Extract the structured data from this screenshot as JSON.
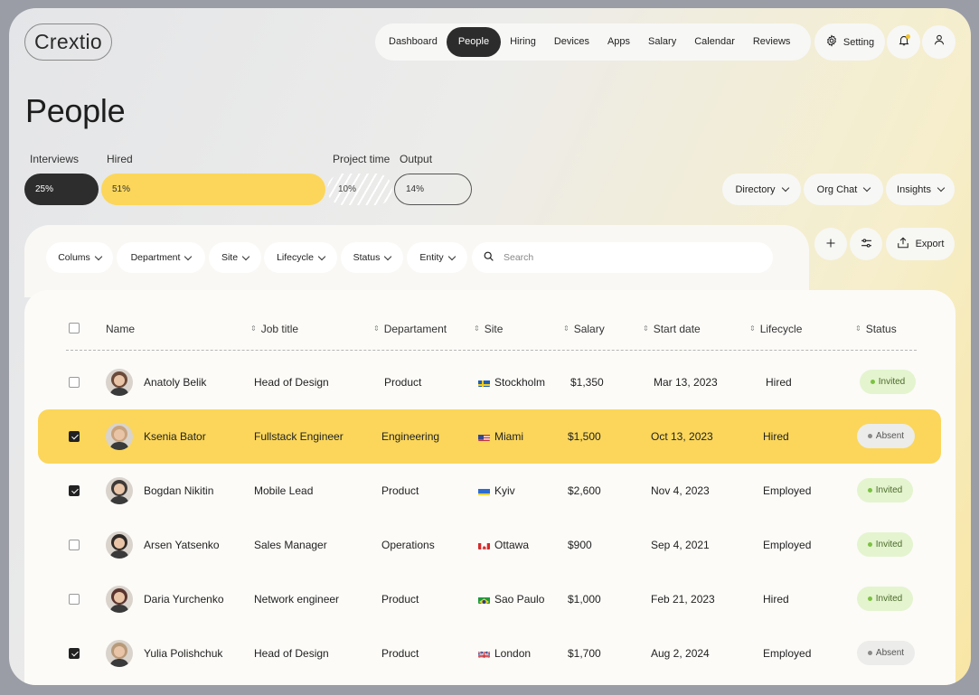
{
  "app": {
    "logo": "Crextio"
  },
  "nav": {
    "items": [
      "Dashboard",
      "People",
      "Hiring",
      "Devices",
      "Apps",
      "Salary",
      "Calendar",
      "Reviews"
    ],
    "active": "People",
    "setting_label": "Setting"
  },
  "page": {
    "title": "People"
  },
  "stats": {
    "labels": {
      "interviews": "Interviews",
      "hired": "Hired",
      "project_time": "Project time",
      "output": "Output"
    },
    "values": {
      "interviews": "25%",
      "hired": "51%",
      "project_time": "10%",
      "output": "14%"
    }
  },
  "views": {
    "directory": "Directory",
    "org_chat": "Org Chat",
    "insights": "Insights"
  },
  "filters": {
    "colums": "Colums",
    "department": "Department",
    "site": "Site",
    "lifecycle": "Lifecycle",
    "status": "Status",
    "entity": "Entity",
    "search_placeholder": "Search"
  },
  "tools": {
    "export": "Export"
  },
  "table": {
    "headers": {
      "name": "Name",
      "job_title": "Job title",
      "department": "Departament",
      "site": "Site",
      "salary": "Salary",
      "start_date": "Start date",
      "lifecycle": "Lifecycle",
      "status": "Status"
    },
    "rows": [
      {
        "name": "Anatoly Belik",
        "job": "Head of Design",
        "dept": "Product",
        "site": "Stockholm",
        "flag": "se",
        "salary": "$1,350",
        "start": "Mar 13, 2023",
        "lifecycle": "Hired",
        "status": "Invited",
        "checked": false,
        "highlight": false,
        "avatar_color": "#6b4a3a"
      },
      {
        "name": "Ksenia Bator",
        "job": "Fullstack Engineer",
        "dept": "Engineering",
        "site": "Miami",
        "flag": "us",
        "salary": "$1,500",
        "start": "Oct 13, 2023",
        "lifecycle": "Hired",
        "status": "Absent",
        "checked": true,
        "highlight": true,
        "avatar_color": "#c9a27e"
      },
      {
        "name": "Bogdan Nikitin",
        "job": "Mobile Lead",
        "dept": "Product",
        "site": "Kyiv",
        "flag": "ua",
        "salary": "$2,600",
        "start": "Nov 4, 2023",
        "lifecycle": "Employed",
        "status": "Invited",
        "checked": true,
        "highlight": false,
        "avatar_color": "#3e3a38"
      },
      {
        "name": "Arsen Yatsenko",
        "job": "Sales Manager",
        "dept": "Operations",
        "site": "Ottawa",
        "flag": "ca",
        "salary": "$900",
        "start": "Sep 4, 2021",
        "lifecycle": "Employed",
        "status": "Invited",
        "checked": false,
        "highlight": false,
        "avatar_color": "#2f2a26"
      },
      {
        "name": "Daria Yurchenko",
        "job": "Network engineer",
        "dept": "Product",
        "site": "Sao Paulo",
        "flag": "br",
        "salary": "$1,000",
        "start": "Feb 21, 2023",
        "lifecycle": "Hired",
        "status": "Invited",
        "checked": false,
        "highlight": false,
        "avatar_color": "#5a3530"
      },
      {
        "name": "Yulia Polishchuk",
        "job": "Head of Design",
        "dept": "Product",
        "site": "London",
        "flag": "gb",
        "salary": "$1,700",
        "start": "Aug 2, 2024",
        "lifecycle": "Employed",
        "status": "Absent",
        "checked": true,
        "highlight": false,
        "avatar_color": "#b89a7a"
      }
    ]
  },
  "colors": {
    "accent_yellow": "#fbd65a",
    "dark": "#2d2d2d",
    "invited_bg": "#e4f4cf",
    "absent_bg": "#ececea"
  }
}
